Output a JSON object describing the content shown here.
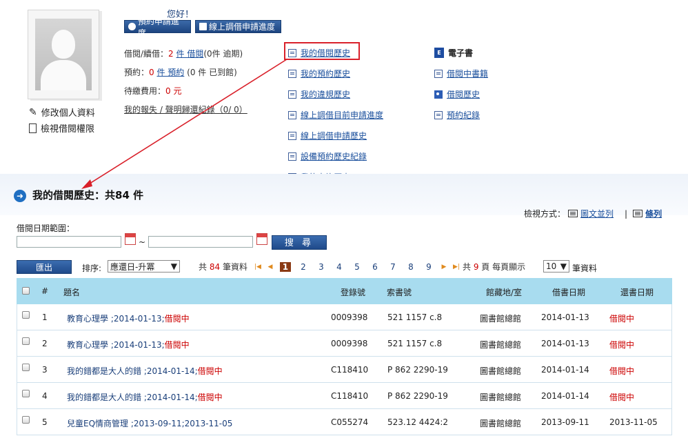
{
  "profile": {
    "greeting": "您好！",
    "edit_label": "修改個人資料",
    "perm_label": "檢視借閱權限"
  },
  "header_buttons": {
    "reserve_progress": "預約申請進度",
    "ill_progress": "線上調借申請進度"
  },
  "summary": {
    "borrow_label": "借閱/續借：",
    "borrow_count": "2",
    "borrow_unit": "件 借閱",
    "overdue_open": "(0件",
    "overdue_label": "逾期)",
    "reserve_label": "預約：",
    "reserve_count": "0",
    "reserve_unit": "件 預約",
    "arrived_open": "(0",
    "arrived_label": "件 已到館)",
    "fee_label": "待繳費用：",
    "fee_value": "0 元",
    "lost_link": "我的報失 / 聲明歸還紀錄（0/ 0）"
  },
  "history_links": [
    "我的借閱歷史",
    "我的預約歷史",
    "我的違規歷史",
    "線上調借目前申請進度",
    "線上調借申請歷史",
    "設備預約歷史紀錄",
    "我的查詢歷史"
  ],
  "ebook": {
    "heading": "電子書",
    "icon_text": "E",
    "links": [
      "借閱中書籍",
      "借閱歷史",
      "預約紀錄"
    ]
  },
  "section": {
    "title": "我的借閱歷史：共",
    "count": "84",
    "unit": "件"
  },
  "view_mode": {
    "label": "檢視方式：",
    "option_grid": "圖文並列",
    "separator": "|",
    "option_list": "條列"
  },
  "filter": {
    "date_range_label": "借閱日期範圍：",
    "tilde": "~",
    "search_button": "搜 尋"
  },
  "toolbar": {
    "export_button": "匯出",
    "sort_label": "排序:",
    "sort_value": "應還日-升冪",
    "total_prefix": "共",
    "total_count": "84",
    "total_suffix": "筆資料",
    "pages": [
      "1",
      "2",
      "3",
      "4",
      "5",
      "6",
      "7",
      "8",
      "9"
    ],
    "current_page": "1",
    "page_total_prefix": "共",
    "page_total": "9",
    "page_total_suffix": "頁",
    "per_page_label": "每頁顯示",
    "per_page_value": "10",
    "per_page_suffix": "筆資料"
  },
  "table": {
    "headers": {
      "num": "#",
      "title": "題名",
      "barcode": "登錄號",
      "callno": "索書號",
      "location": "館藏地/室",
      "borrow_date": "借書日期",
      "return_date": "還書日期"
    },
    "rows": [
      {
        "num": "1",
        "title": "教育心理學 ;2014-01-13;",
        "status": "借閱中",
        "barcode": "0009398",
        "callno": "521 1157 c.8",
        "location": "圖書館總館",
        "borrow_date": "2014-01-13",
        "return_date": "借閱中"
      },
      {
        "num": "2",
        "title": "教育心理學 ;2014-01-13;",
        "status": "借閱中",
        "barcode": "0009398",
        "callno": "521 1157 c.8",
        "location": "圖書館總館",
        "borrow_date": "2014-01-13",
        "return_date": "借閱中"
      },
      {
        "num": "3",
        "title": "我的錯都是大人的錯 ;2014-01-14;",
        "status": "借閱中",
        "barcode": "C118410",
        "callno": "P 862 2290-19",
        "location": "圖書館總館",
        "borrow_date": "2014-01-14",
        "return_date": "借閱中"
      },
      {
        "num": "4",
        "title": "我的錯都是大人的錯 ;2014-01-14;",
        "status": "借閱中",
        "barcode": "C118410",
        "callno": "P 862 2290-19",
        "location": "圖書館總館",
        "borrow_date": "2014-01-14",
        "return_date": "借閱中"
      },
      {
        "num": "5",
        "title": "兒童EQ情商管理 ;2013-09-11;2013-11-05",
        "status": "",
        "barcode": "C055274",
        "callno": "523.12 4424:2",
        "location": "圖書館總館",
        "borrow_date": "2013-09-11",
        "return_date": "2013-11-05"
      }
    ]
  },
  "colors": {
    "accent": "#1f4a8a",
    "header_bg": "#a8dcef",
    "highlight": "#d9202a",
    "status_red": "#cc0000"
  }
}
